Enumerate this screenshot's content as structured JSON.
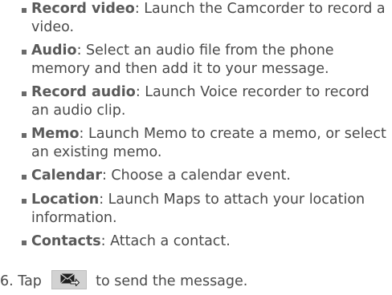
{
  "items": [
    {
      "term": "Record video",
      "desc": ": Launch the Camcorder to record a video."
    },
    {
      "term": "Audio",
      "desc": ": Select an audio file from the phone memory and then add it to your message."
    },
    {
      "term": "Record audio",
      "desc": ": Launch Voice recorder to record an audio clip."
    },
    {
      "term": "Memo",
      "desc": ": Launch Memo to create a memo, or select an existing memo."
    },
    {
      "term": "Calendar",
      "desc": ": Choose a calendar event."
    },
    {
      "term": "Location",
      "desc": ": Launch Maps to attach your location information."
    },
    {
      "term": "Contacts",
      "desc": ": Attach a contact."
    }
  ],
  "step": {
    "number": "6.",
    "text_before": "Tap",
    "text_after": "to send the message.",
    "icon": "send-message-icon"
  }
}
